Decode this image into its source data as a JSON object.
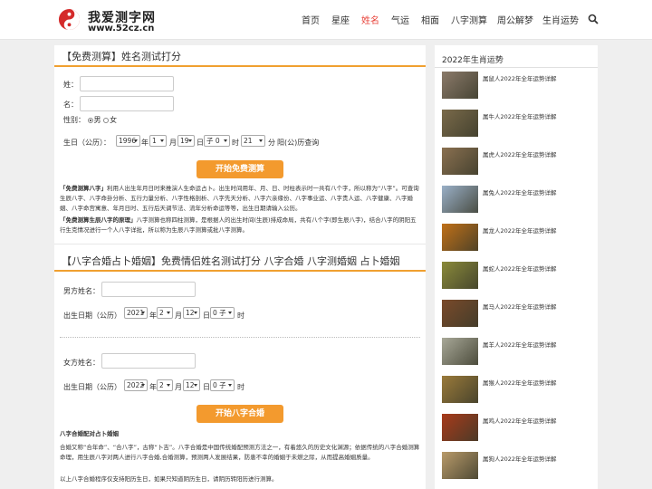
{
  "header": {
    "title": "我爱测字网",
    "url": "www.52cz.cn",
    "nav": [
      "首页",
      "星座",
      "姓名",
      "气运",
      "相面",
      "八字测算",
      "周公解梦",
      "生肖运势"
    ],
    "active_nav": "姓名"
  },
  "name_test": {
    "title": "【免费测算】姓名测试打分",
    "surname_label": "姓：",
    "name_label": "名：",
    "gender_label": "性别：",
    "gender_male": "男",
    "gender_female": "女",
    "birth_label": "生日（公历）：",
    "year": "1996",
    "year_unit": "年",
    "month": "1",
    "month_unit": "月",
    "day": "19",
    "day_unit": "日",
    "hour": "子 0",
    "hour_unit": "时",
    "minute": "21",
    "minute_unit": "分",
    "lunar_link": "阳(公)历查询",
    "button": "开始免费测算",
    "para1_bold": "「免费测算八字」",
    "para1": "利用人出生年月日时来推演人生命运占卜。出生时间用年、月、日、时柱表示时一共有八个字，所以称为“八字”。可查询生辰八字、八字命卦分析、五行力量分析、八字性格剖析、八字先天分析、八字六亲缘份、八字事业运、八字贵人运、八字健康、八字婚姻、八字命宫寓意、年月日时、五行后天调节法、流年分析命运等等，出生日期请输入公历。",
    "para2_bold": "「免费测算生辰八字的原理」",
    "para2": "八字测算也称四柱测算，是根据人的出生时间(生辰)排成命局，共有八个字(即生辰八字)，结合八字的阴阳五行生克情况进行一个人八字详批，所以称为生辰八字测算或批八字测算。"
  },
  "marriage": {
    "title": "【八字合婚占卜婚姻】免费情侣姓名测试打分 八字合婚 八字测婚姻 占卜婚姻",
    "male_name_label": "男方姓名：",
    "male_birth_label": "出生日期（公历）",
    "male_year": "2021",
    "male_month": "2",
    "male_day": "12",
    "male_hour": "0 子",
    "female_name_label": "女方姓名：",
    "female_birth_label": "出生日期（公历）",
    "female_year": "2022",
    "female_month": "2",
    "female_day": "12",
    "female_hour": "0 子",
    "year_unit": "年",
    "month_unit": "月",
    "day_unit": "日",
    "hour_unit": "时",
    "button": "开始八字合婚",
    "sub_title": "八字合婚配对占卜婚姻",
    "para1": "合婚又称“合年命”、“合八字”，古称“卜吉”。八字合婚是中国传统婚配预测方法之一，有着悠久的历史文化渊源；依据传统的八字合婚测算命理，用生辰八字对两人进行八字合婚,合婚测算，预测两人发展结果，防患不幸的婚姻于未燃之际，从而提高婚姻质量。",
    "para2": "以上八字合婚程序仅支持阳历生日，如果只知道阴历生日，请阴历转阳历进行测算。"
  },
  "sidebar": {
    "title": "2022年生肖运势",
    "items": [
      {
        "label": "属鼠人2022年全年运势详解",
        "icon": "rat-photo",
        "color": "#8b7a6a"
      },
      {
        "label": "属牛人2022年全年运势详解",
        "icon": "ox-photo",
        "color": "#7a6a4a"
      },
      {
        "label": "属虎人2022年全年运势详解",
        "icon": "tiger-photo",
        "color": "#8a7050"
      },
      {
        "label": "属兔人2022年全年运势详解",
        "icon": "rabbit-photo",
        "color": "#9ab0c8"
      },
      {
        "label": "属龙人2022年全年运势详解",
        "icon": "dragon-photo",
        "color": "#c07018"
      },
      {
        "label": "属蛇人2022年全年运势详解",
        "icon": "snake-photo",
        "color": "#8a8a3a"
      },
      {
        "label": "属马人2022年全年运势详解",
        "icon": "horse-photo",
        "color": "#7a4a2a"
      },
      {
        "label": "属羊人2022年全年运势详解",
        "icon": "goat-photo",
        "color": "#a8a898"
      },
      {
        "label": "属猴人2022年全年运势详解",
        "icon": "monkey-photo",
        "color": "#9a7a3a"
      },
      {
        "label": "属鸡人2022年全年运势详解",
        "icon": "rooster-photo",
        "color": "#a83a1a"
      },
      {
        "label": "属狗人2022年全年运势详解",
        "icon": "dog-photo",
        "color": "#b89a6a"
      }
    ]
  }
}
